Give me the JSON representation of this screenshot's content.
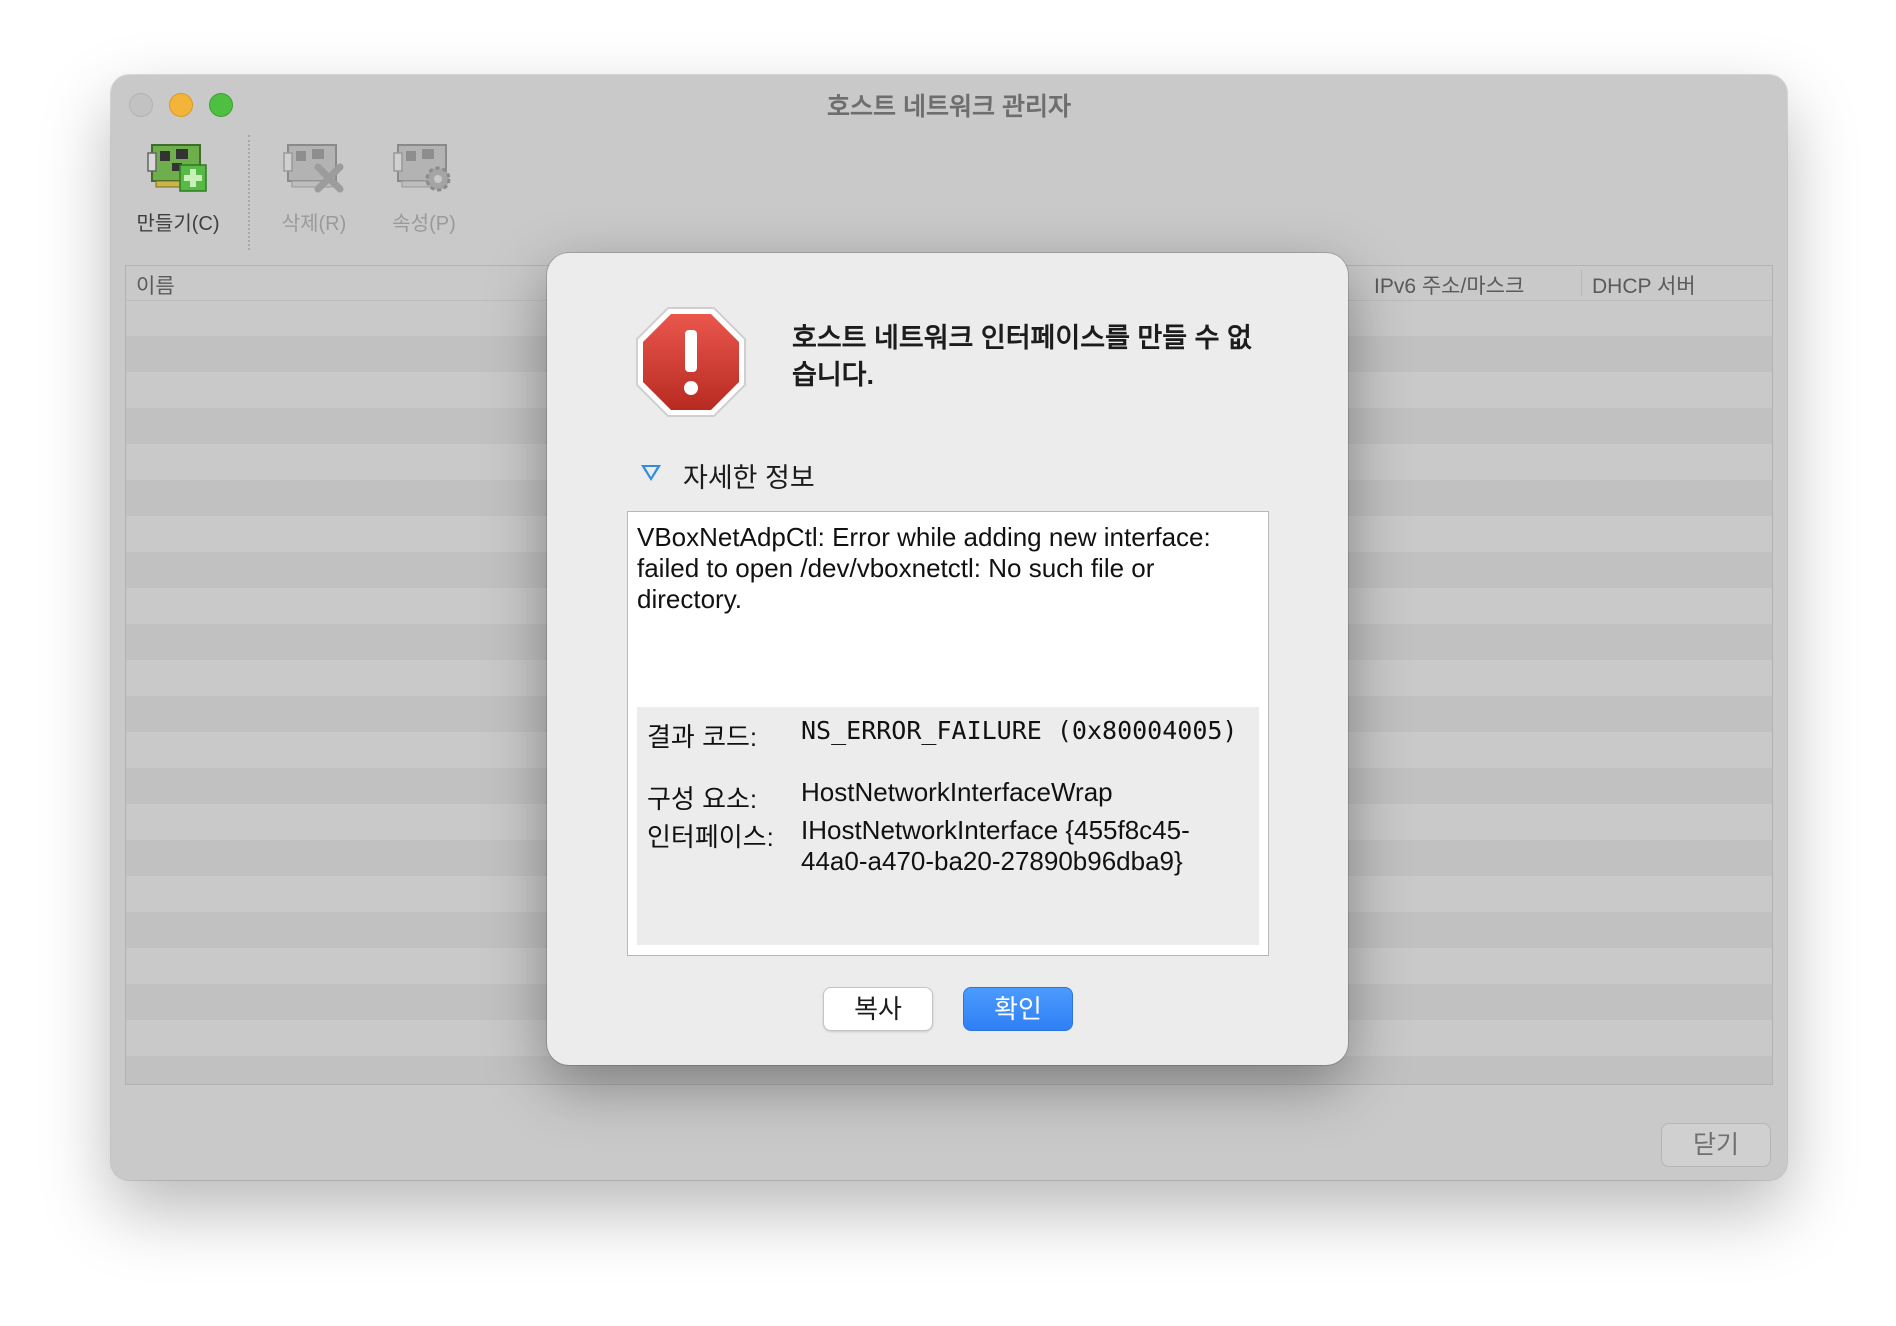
{
  "window": {
    "title": "호스트 네트워크 관리자",
    "close_button": "닫기"
  },
  "toolbar": {
    "create_label": "만들기(C)",
    "delete_label": "삭제(R)",
    "properties_label": "속성(P)"
  },
  "table": {
    "columns": [
      "이름",
      "IPv6 주소/마스크",
      "DHCP 서버"
    ]
  },
  "dialog": {
    "message": "호스트 네트워크 인터페이스를 만들 수 없습니다.",
    "details_label": "자세한 정보",
    "details_text": "VBoxNetAdpCtl: Error while adding new interface: failed to open /dev/vboxnetctl: No such file or directory.",
    "result_code_key": "결과 코드:",
    "result_code_value": "NS_ERROR_FAILURE (0x80004005)",
    "component_key": "구성 요소:",
    "component_value": "HostNetworkInterfaceWrap",
    "interface_key": "인터페이스:",
    "interface_value": "IHostNetworkInterface {455f8c45-44a0-a470-ba20-27890b96dba9}",
    "copy_button": "복사",
    "ok_button": "확인"
  },
  "colors": {
    "accent": "#2f7ff5",
    "error_red": "#c8322a"
  },
  "icons": [
    "network-card-add-icon",
    "network-card-remove-icon",
    "network-card-settings-icon",
    "error-stop-icon",
    "disclosure-triangle-icon"
  ]
}
